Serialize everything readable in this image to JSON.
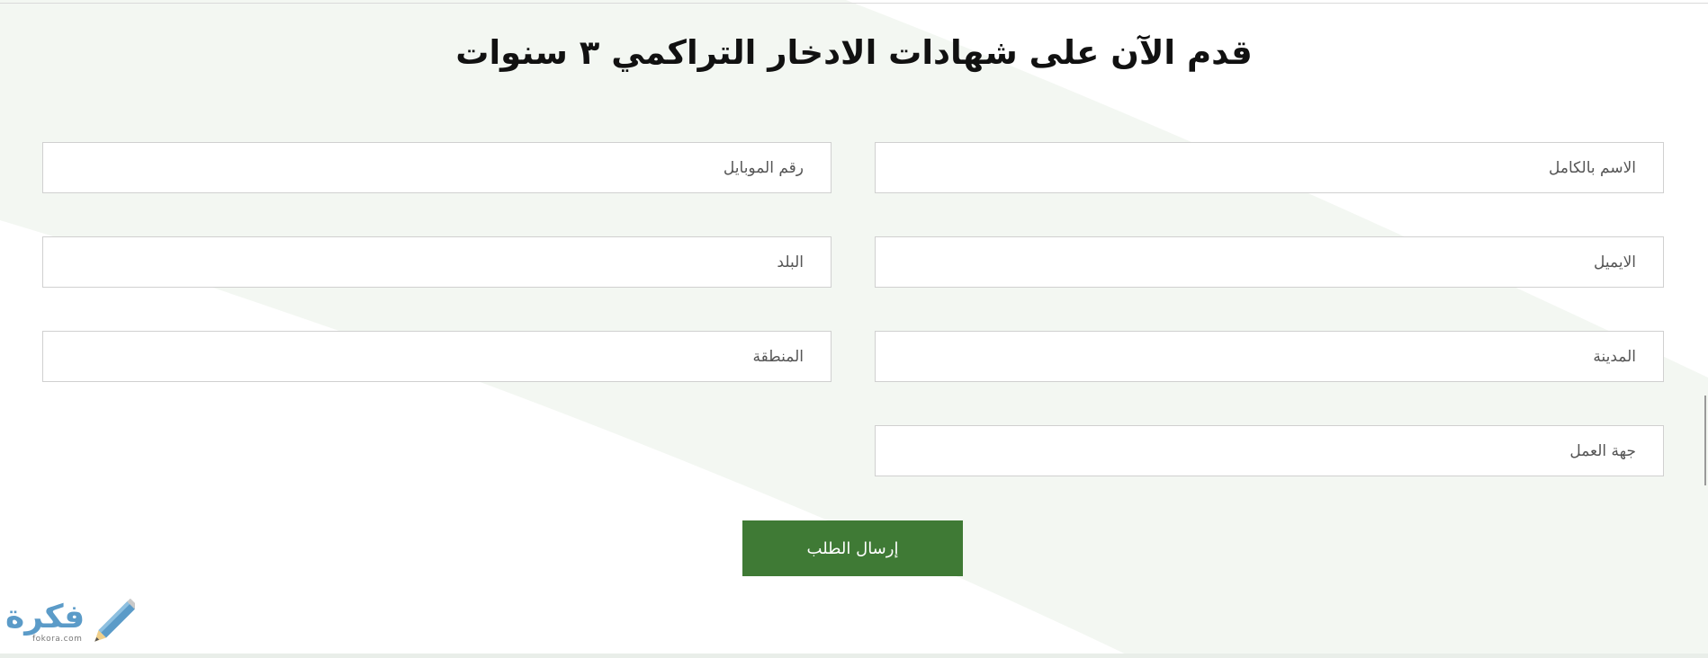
{
  "form": {
    "title": "قدم الآن على شهادات الادخار التراكمي ٣ سنوات",
    "fields": {
      "full_name": {
        "placeholder": "الاسم بالكامل",
        "value": ""
      },
      "mobile": {
        "placeholder": "رقم الموبايل",
        "value": ""
      },
      "email": {
        "placeholder": "الايميل",
        "value": ""
      },
      "country": {
        "placeholder": "البلد",
        "value": ""
      },
      "city": {
        "placeholder": "المدينة",
        "value": ""
      },
      "region": {
        "placeholder": "المنطقة",
        "value": ""
      },
      "employer": {
        "placeholder": "جهة العمل",
        "value": ""
      }
    },
    "submit_label": "إرسال الطلب"
  },
  "watermark": {
    "logo_text": "فكرة",
    "logo_url_text": "fokora.com",
    "icon": "pencil-icon"
  },
  "colors": {
    "accent": "#3f7a35",
    "background_shape": "#f3f7f2",
    "logo": "#5b9bc8"
  }
}
